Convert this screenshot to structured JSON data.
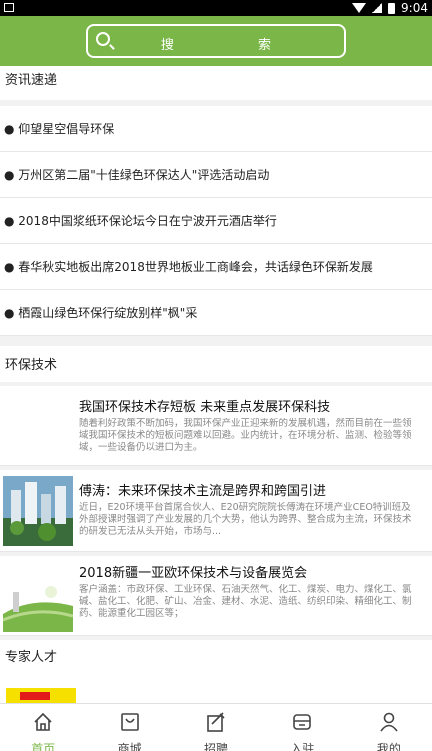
{
  "status_bar": {
    "time": "9:04"
  },
  "search": {
    "placeholder": "搜 索"
  },
  "news": {
    "title": "资讯速递",
    "items": [
      "● 仰望星空倡导环保",
      "● 万州区第二届\"十佳绿色环保达人\"评选活动启动",
      "● 2018中国浆纸环保论坛今日在宁波开元酒店举行",
      "● 春华秋实地板出席2018世界地板业工商峰会，共话绿色环保新发展",
      "● 栖霞山绿色环保行绽放别样\"枫\"采"
    ]
  },
  "tech": {
    "title": "环保技术",
    "articles": [
      {
        "title": "我国环保技术存短板 未来重点发展环保科技",
        "desc": "随着利好政策不断加码，我国环保产业正迎来新的发展机遇，然而目前在一些领域我国环保技术的短板问题难以回避。业内统计，在环境分析、监测、检验等领域，一些设备仍以进口为主。"
      },
      {
        "title": "傅涛：未来环保技术主流是跨界和跨国引进",
        "desc": "近日，E20环境平台首席合伙人、E20研究院院长傅涛在环境产业CEO特训班及外部授课时强调了产业发展的几个大势，他认为跨界、整合成为主流，环保技术的研发已无法从头开始，市场与..."
      },
      {
        "title": "2018新疆一亚欧环保技术与设备展览会",
        "desc": "客户涵盖：市政环保、工业环保、石油天然气、化工、煤炭、电力、煤化工、氯碱、盐化工、化肥、矿山、冶金、建材、水泥、造纸、纺织印染、精细化工、制药、能源重化工园区等；"
      }
    ]
  },
  "experts": {
    "title": "专家人才"
  },
  "tabbar": [
    {
      "label": "首页",
      "icon": "home-icon"
    },
    {
      "label": "商城",
      "icon": "shop-icon"
    },
    {
      "label": "招聘",
      "icon": "recruit-icon"
    },
    {
      "label": "入驻",
      "icon": "join-icon"
    },
    {
      "label": "我的",
      "icon": "profile-icon"
    }
  ],
  "colors": {
    "brand": "#7ab648",
    "active_tab": "#7ab648"
  }
}
